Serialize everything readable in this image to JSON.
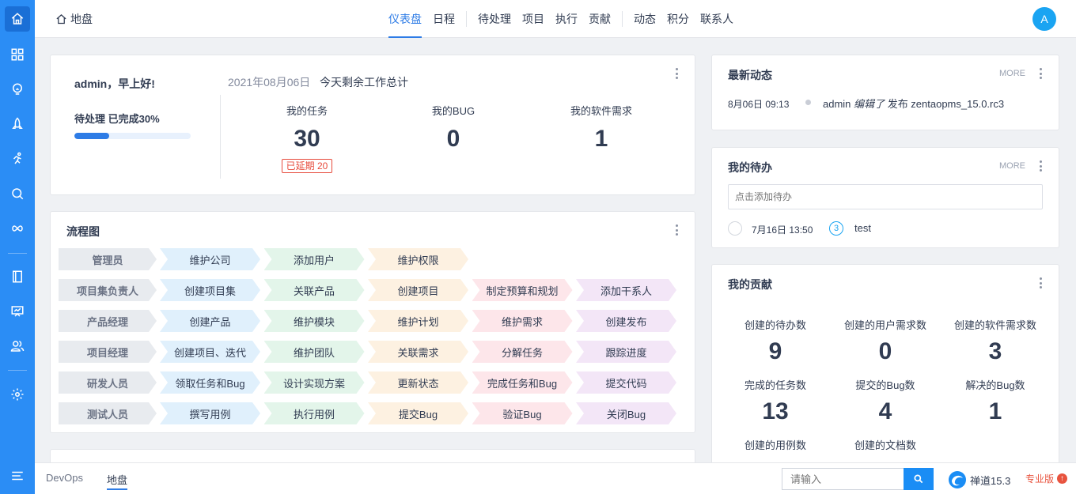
{
  "sidebar": {
    "icons": [
      "home-icon",
      "apps-grid-icon",
      "lightbulb-icon",
      "rocket-icon",
      "runner-icon",
      "search-circle-icon",
      "infinity-icon",
      "document-icon",
      "whiteboard-icon",
      "team-icon",
      "gear-icon"
    ],
    "menu_icon": "menu-icon"
  },
  "header": {
    "breadcrumb": "地盘",
    "nav": [
      "仪表盘",
      "日程",
      "待处理",
      "项目",
      "执行",
      "贡献",
      "动态",
      "积分",
      "联系人"
    ],
    "active_nav": "仪表盘",
    "avatar": "A"
  },
  "welcome": {
    "greeting": "admin，早上好!",
    "progress_text": "待处理 已完成30%",
    "progress_fraction": 0.3,
    "date": "2021年08月06日",
    "summary": "今天剩余工作总计",
    "stats": [
      {
        "label": "我的任务",
        "value": "30",
        "badge": "已延期 20"
      },
      {
        "label": "我的BUG",
        "value": "0"
      },
      {
        "label": "我的软件需求",
        "value": "1"
      }
    ]
  },
  "flowchart": {
    "title": "流程图",
    "rows": [
      {
        "role": "管理员",
        "steps": [
          "维护公司",
          "添加用户",
          "维护权限"
        ]
      },
      {
        "role": "项目集负责人",
        "steps": [
          "创建项目集",
          "关联产品",
          "创建项目",
          "制定预算和规划",
          "添加干系人"
        ]
      },
      {
        "role": "产品经理",
        "steps": [
          "创建产品",
          "维护模块",
          "维护计划",
          "维护需求",
          "创建发布"
        ]
      },
      {
        "role": "项目经理",
        "steps": [
          "创建项目、迭代",
          "维护团队",
          "关联需求",
          "分解任务",
          "跟踪进度"
        ]
      },
      {
        "role": "研发人员",
        "steps": [
          "领取任务和Bug",
          "设计实现方案",
          "更新状态",
          "完成任务和Bug",
          "提交代码"
        ]
      },
      {
        "role": "测试人员",
        "steps": [
          "撰写用例",
          "执行用例",
          "提交Bug",
          "验证Bug",
          "关闭Bug"
        ]
      }
    ],
    "colors": [
      "#e0f0fc",
      "#e3f5ea",
      "#fdf1e1",
      "#fde6ea",
      "#f3e6f7"
    ],
    "role_color": "#e8ebef"
  },
  "news": {
    "title": "最新动态",
    "more": "MORE",
    "items": [
      {
        "time": "8月06日 09:13",
        "user": "admin",
        "action": "编辑了",
        "object": "发布 zentaopms_15.0.rc3"
      }
    ]
  },
  "todo": {
    "title": "我的待办",
    "more": "MORE",
    "placeholder": "点击添加待办",
    "items": [
      {
        "time": "7月16日 13:50",
        "priority": "3",
        "name": "test"
      }
    ]
  },
  "contributions": {
    "title": "我的贡献",
    "items": [
      {
        "label": "创建的待办数",
        "value": "9"
      },
      {
        "label": "创建的用户需求数",
        "value": "0"
      },
      {
        "label": "创建的软件需求数",
        "value": "3"
      },
      {
        "label": "完成的任务数",
        "value": "13"
      },
      {
        "label": "提交的Bug数",
        "value": "4"
      },
      {
        "label": "解决的Bug数",
        "value": "1"
      },
      {
        "label": "创建的用例数",
        "value": ""
      },
      {
        "label": "创建的文档数",
        "value": ""
      }
    ]
  },
  "footer": {
    "tabs": [
      "DevOps",
      "地盘"
    ],
    "active_tab": "地盘",
    "search_placeholder": "请输入",
    "brand": "禅道15.3",
    "edition": "专业版",
    "edition_badge": "↑"
  },
  "colors": {
    "accent": "#2e7ce6",
    "sidebar": "#2b8df5",
    "overdue": "#e74b3c"
  }
}
